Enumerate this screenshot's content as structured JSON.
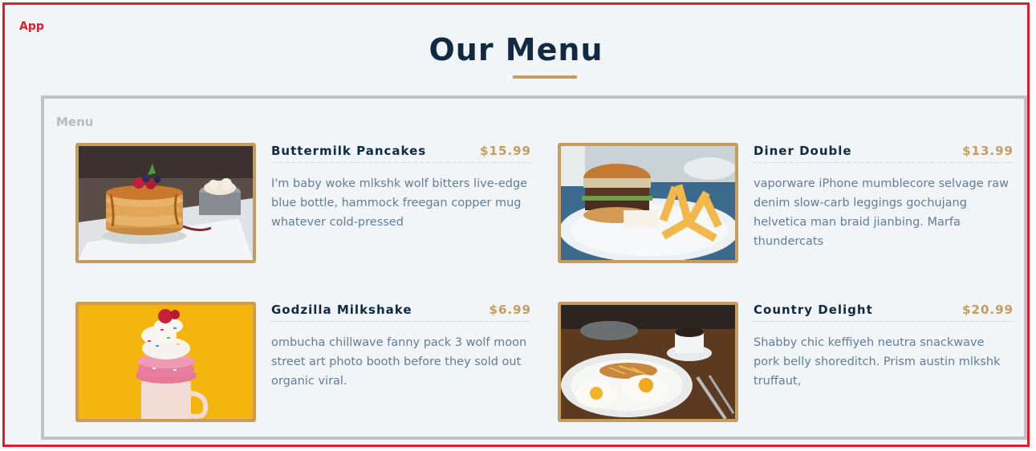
{
  "app": {
    "label": "App"
  },
  "page": {
    "title": "Our Menu"
  },
  "menu": {
    "label": "Menu",
    "items": [
      {
        "name": "Buttermilk Pancakes",
        "price": "$15.99",
        "description": "I'm baby woke mlkshk wolf bitters live-edge blue bottle, hammock freegan copper mug whatever cold-pressed",
        "image": "pancakes-photo"
      },
      {
        "name": "Diner Double",
        "price": "$13.99",
        "description": "vaporware iPhone mumblecore selvage raw denim slow-carb leggings gochujang helvetica man braid jianbing. Marfa thundercats",
        "image": "burger-photo"
      },
      {
        "name": "Godzilla Milkshake",
        "price": "$6.99",
        "description": "ombucha chillwave fanny pack 3 wolf moon street art photo booth before they sold out organic viral.",
        "image": "milkshake-photo"
      },
      {
        "name": "Country Delight",
        "price": "$20.99",
        "description": "Shabby chic keffiyeh neutra snackwave pork belly shoreditch. Prism austin mlkshk truffaut,",
        "image": "breakfast-photo"
      }
    ]
  },
  "colors": {
    "app_outline": "#e11d2c",
    "accent": "#c59d5f",
    "heading": "#102a42",
    "text": "#617d98",
    "background": "#f1f5f8",
    "menu_border": "#bfc3c6"
  }
}
